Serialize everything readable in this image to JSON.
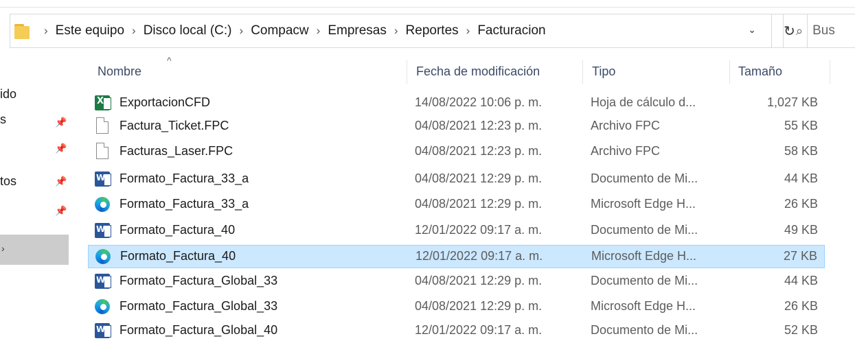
{
  "address_bar": {
    "crumbs": [
      "Este equipo",
      "Disco local (C:)",
      "Compacw",
      "Empresas",
      "Reportes",
      "Facturacion"
    ],
    "dropdown_icon": "chevron-down-icon",
    "refresh_icon": "refresh-icon"
  },
  "search": {
    "placeholder": "Bus"
  },
  "nav_pane": {
    "items": [
      {
        "label": "ido",
        "pinned": false
      },
      {
        "label": "s",
        "pinned": true
      },
      {
        "label": "",
        "pinned": true
      },
      {
        "label": "tos",
        "pinned": true
      },
      {
        "label": "",
        "pinned": true
      },
      {
        "label": "",
        "pinned": false,
        "selected": true
      }
    ]
  },
  "columns": {
    "name": "Nombre",
    "date": "Fecha de modificación",
    "type": "Tipo",
    "size": "Tamaño"
  },
  "files": [
    {
      "name": "ExportacionCFD",
      "date": "14/08/2022 10:06 p. m.",
      "type": "Hoja de cálculo d...",
      "size": "1,027 KB",
      "icon": "excel-icon",
      "selected": false
    },
    {
      "name": "Factura_Ticket.FPC",
      "date": "04/08/2021 12:23 p. m.",
      "type": "Archivo FPC",
      "size": "55 KB",
      "icon": "file-icon",
      "selected": false
    },
    {
      "name": "Facturas_Laser.FPC",
      "date": "04/08/2021 12:23 p. m.",
      "type": "Archivo FPC",
      "size": "58 KB",
      "icon": "file-icon",
      "selected": false
    },
    {
      "name": "Formato_Factura_33_a",
      "date": "04/08/2021 12:29 p. m.",
      "type": "Documento de Mi...",
      "size": "44 KB",
      "icon": "word-icon",
      "selected": false
    },
    {
      "name": "Formato_Factura_33_a",
      "date": "04/08/2021 12:29 p. m.",
      "type": "Microsoft Edge H...",
      "size": "26 KB",
      "icon": "edge-icon",
      "selected": false
    },
    {
      "name": "Formato_Factura_40",
      "date": "12/01/2022 09:17 a. m.",
      "type": "Documento de Mi...",
      "size": "49 KB",
      "icon": "word-icon",
      "selected": false
    },
    {
      "name": "Formato_Factura_40",
      "date": "12/01/2022 09:17 a. m.",
      "type": "Microsoft Edge H...",
      "size": "27 KB",
      "icon": "edge-icon",
      "selected": true
    },
    {
      "name": "Formato_Factura_Global_33",
      "date": "04/08/2021 12:29 p. m.",
      "type": "Documento de Mi...",
      "size": "44 KB",
      "icon": "word-icon",
      "selected": false
    },
    {
      "name": "Formato_Factura_Global_33",
      "date": "04/08/2021 12:29 p. m.",
      "type": "Microsoft Edge H...",
      "size": "26 KB",
      "icon": "edge-icon",
      "selected": false
    },
    {
      "name": "Formato_Factura_Global_40",
      "date": "12/01/2022 09:17 a. m.",
      "type": "Documento de Mi...",
      "size": "52 KB",
      "icon": "word-icon",
      "selected": false
    }
  ],
  "colors": {
    "selection_bg": "#cce8ff",
    "selection_border": "#99d1ff",
    "header_text": "#3b4a66"
  }
}
